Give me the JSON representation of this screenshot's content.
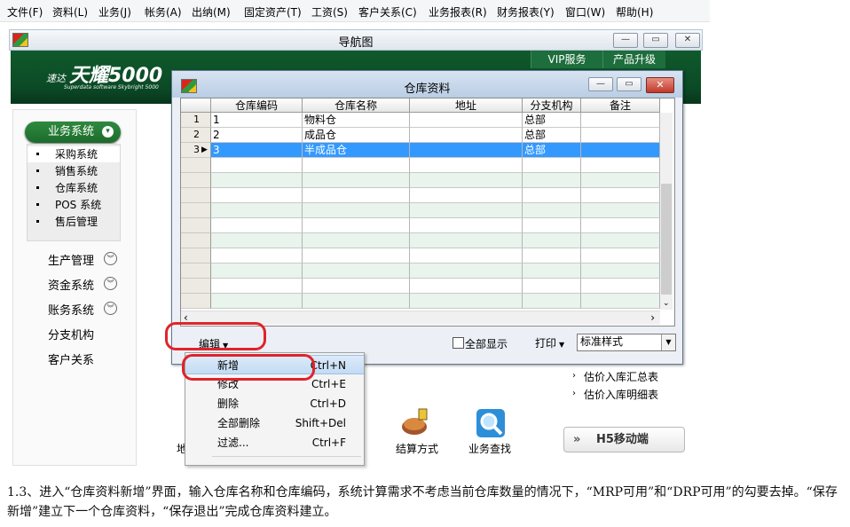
{
  "menubar": [
    "文件(F)",
    "资料(L)",
    "业务(J)",
    "帐务(A)",
    "出纳(M)",
    "固定资产(T)",
    "工资(S)",
    "客户关系(C)",
    "业务报表(R)",
    "财务报表(Y)",
    "窗口(W)",
    "帮助(H)"
  ],
  "nav_window": {
    "title": "导航图",
    "vip": "VIP服务",
    "upgrade": "产品升级",
    "logo_prefix": "速达",
    "logo_text": "天耀5000",
    "logo_sub": "Superdata software Skybright 5000",
    "biz_system": "业务系统",
    "sub_items": [
      "采购系统",
      "销售系统",
      "仓库系统",
      "POS 系统",
      "售后管理"
    ],
    "groups": [
      "生产管理",
      "资金系统",
      "账务系统",
      "分支机构",
      "客户关系"
    ],
    "right_links": [
      "估价入库汇总表",
      "估价入库明细表"
    ],
    "h5_button": "H5移动端",
    "icon_labels": [
      "地",
      "结算方式",
      "业务查找"
    ]
  },
  "dialog": {
    "title": "仓库资料",
    "columns": [
      "",
      "仓库编码",
      "仓库名称",
      "地址",
      "分支机构",
      "备注"
    ],
    "rows": [
      {
        "no": "1",
        "code": "1",
        "name": "物料仓",
        "address": "",
        "branch": "总部",
        "note": ""
      },
      {
        "no": "2",
        "code": "2",
        "name": "成品仓",
        "address": "",
        "branch": "总部",
        "note": ""
      },
      {
        "no": "3",
        "code": "3",
        "name": "半成品仓",
        "address": "",
        "branch": "总部",
        "note": ""
      }
    ],
    "selected_row": 3,
    "edit_button": "编辑",
    "show_all": "全部显示",
    "print_button": "打印",
    "style_value": "标准样式"
  },
  "popup_menu": [
    {
      "label": "新增",
      "shortcut": "Ctrl+N"
    },
    {
      "label": "修改",
      "shortcut": "Ctrl+E"
    },
    {
      "label": "删除",
      "shortcut": "Ctrl+D"
    },
    {
      "label": "全部删除",
      "shortcut": "Shift+Del"
    },
    {
      "label": "过滤...",
      "shortcut": "Ctrl+F"
    }
  ],
  "caption": "1.3、进入“仓库资料新增”界面，输入仓库名称和仓库编码，系统计算需求不考虑当前仓库数量的情况下，“MRP可用”和“DRP可用”的勾要去掉。“保存新增”建立下一个仓库资料，“保存退出”完成仓库资料建立。",
  "colors": {
    "banner": "#0f5a2c",
    "selection": "#3399ff",
    "annotation": "#e0232b"
  }
}
